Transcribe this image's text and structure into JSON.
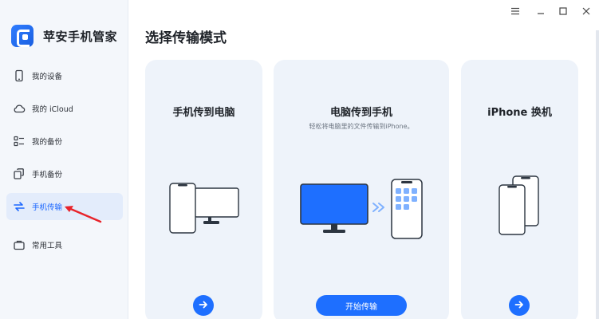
{
  "app": {
    "name": "苹安手机管家",
    "brand_color": "#1e6fff"
  },
  "sidebar": {
    "items": [
      {
        "label": "我的设备",
        "icon": "phone-icon"
      },
      {
        "label": "我的 iCloud",
        "icon": "cloud-icon"
      },
      {
        "label": "我的备份",
        "icon": "backup-list-icon"
      },
      {
        "label": "手机备份",
        "icon": "copy-icon"
      },
      {
        "label": "手机传输",
        "icon": "transfer-arrows-icon",
        "active": true
      },
      {
        "label": "常用工具",
        "icon": "toolbox-icon"
      }
    ]
  },
  "main": {
    "title": "选择传输模式",
    "cards": [
      {
        "title": "手机传到电脑",
        "subtitle": "",
        "action_icon": "arrow-right-icon"
      },
      {
        "title": "电脑传到手机",
        "subtitle": "轻松将电脑里的文件传输到iPhone。",
        "action_label": "开始传输"
      },
      {
        "title": "iPhone 换机",
        "subtitle": "",
        "action_icon": "arrow-right-icon"
      }
    ]
  },
  "window_controls": [
    "menu-icon",
    "minimize-icon",
    "maximize-icon",
    "close-icon"
  ]
}
